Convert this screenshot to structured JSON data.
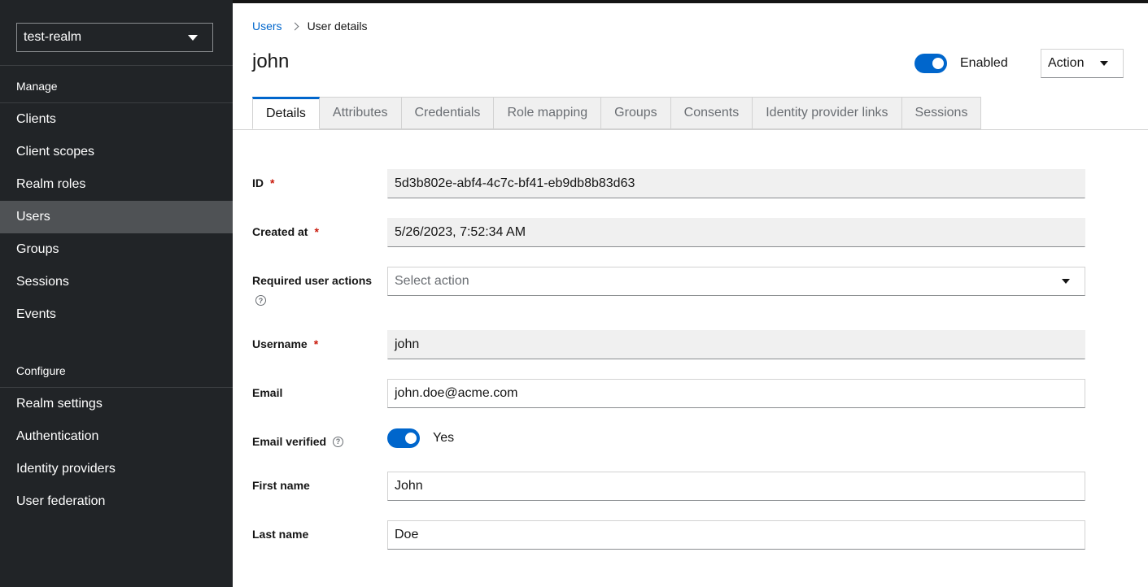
{
  "sidebar": {
    "realm": "test-realm",
    "manage_heading": "Manage",
    "manage_items": [
      {
        "label": "Clients"
      },
      {
        "label": "Client scopes"
      },
      {
        "label": "Realm roles"
      },
      {
        "label": "Users",
        "active": true
      },
      {
        "label": "Groups"
      },
      {
        "label": "Sessions"
      },
      {
        "label": "Events"
      }
    ],
    "configure_heading": "Configure",
    "configure_items": [
      {
        "label": "Realm settings"
      },
      {
        "label": "Authentication"
      },
      {
        "label": "Identity providers"
      },
      {
        "label": "User federation"
      }
    ]
  },
  "breadcrumb": {
    "parent": "Users",
    "current": "User details"
  },
  "header": {
    "title": "john",
    "enabled_label": "Enabled",
    "enabled": true,
    "action_label": "Action"
  },
  "tabs": [
    {
      "label": "Details",
      "active": true
    },
    {
      "label": "Attributes"
    },
    {
      "label": "Credentials"
    },
    {
      "label": "Role mapping"
    },
    {
      "label": "Groups"
    },
    {
      "label": "Consents"
    },
    {
      "label": "Identity provider links"
    },
    {
      "label": "Sessions"
    }
  ],
  "form": {
    "id_label": "ID",
    "id_value": "5d3b802e-abf4-4c7c-bf41-eb9db8b83d63",
    "created_label": "Created at",
    "created_value": "5/26/2023, 7:52:34 AM",
    "required_actions_label": "Required user actions",
    "required_actions_placeholder": "Select action",
    "username_label": "Username",
    "username_value": "john",
    "email_label": "Email",
    "email_value": "john.doe@acme.com",
    "email_verified_label": "Email verified",
    "email_verified_value": "Yes",
    "first_name_label": "First name",
    "first_name_value": "John",
    "last_name_label": "Last name",
    "last_name_value": "Doe",
    "required_marker": "*",
    "help_glyph": "?"
  },
  "colors": {
    "sidebar_bg": "#212427",
    "accent": "#0066cc",
    "required": "#c9190b"
  }
}
